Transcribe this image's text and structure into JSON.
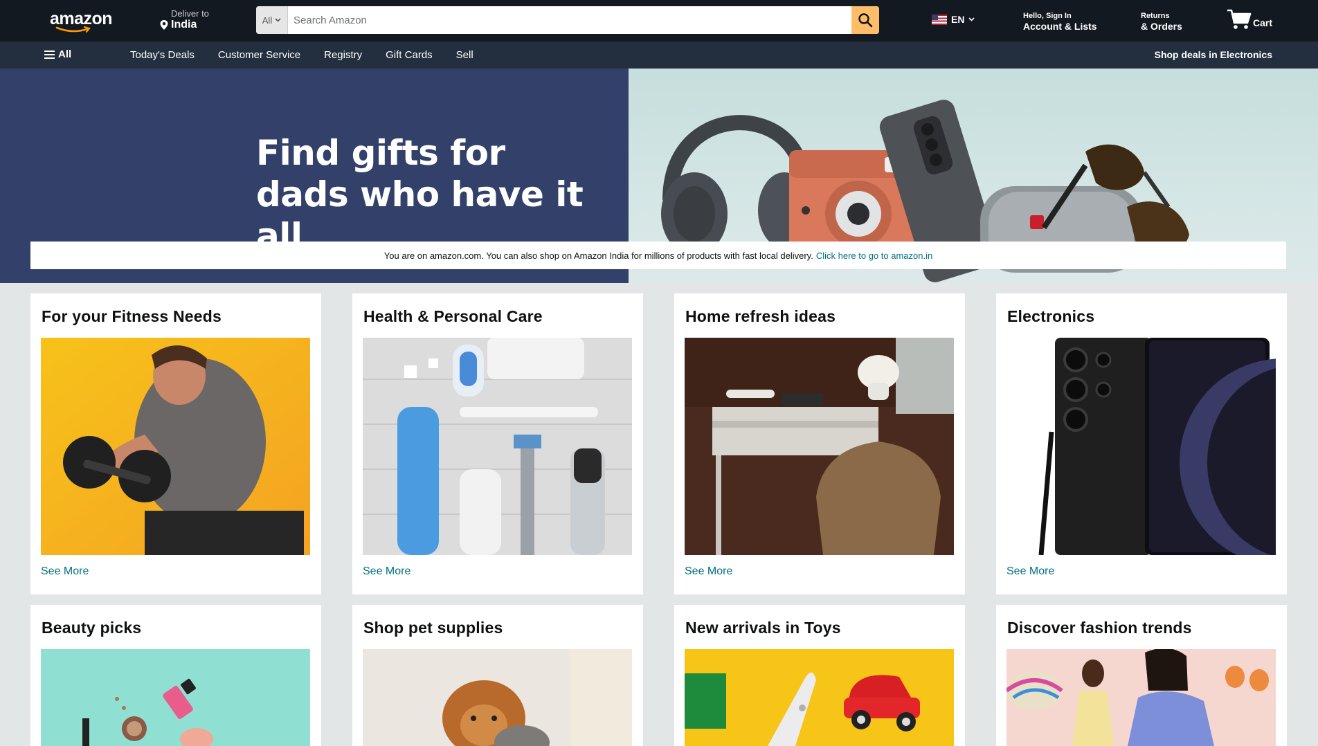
{
  "header": {
    "logo_text": "amazon",
    "deliver_label": "Deliver to",
    "deliver_location": "India",
    "search_category": "All",
    "search_placeholder": "Search Amazon",
    "language": "EN",
    "account_greeting": "Hello, Sign In",
    "account_label": "Account & Lists",
    "returns_label": "Returns",
    "orders_label": "& Orders",
    "cart_label": "Cart"
  },
  "subnav": {
    "all_label": "All",
    "links": [
      "Today's Deals",
      "Customer Service",
      "Registry",
      "Gift Cards",
      "Sell"
    ],
    "promo": "Shop deals in Electronics"
  },
  "hero": {
    "title_line1": "Find gifts for",
    "title_line2": "dads who have it all"
  },
  "notice": {
    "text": "You are on amazon.com. You can also shop on Amazon India for millions of products with fast local delivery.",
    "link": "Click here to go to amazon.in"
  },
  "cards": [
    {
      "title": "For your Fitness Needs",
      "link": "See More"
    },
    {
      "title": "Health & Personal Care",
      "link": "See More"
    },
    {
      "title": "Home refresh ideas",
      "link": "See More"
    },
    {
      "title": "Electronics",
      "link": "See More"
    },
    {
      "title": "Beauty picks",
      "link": ""
    },
    {
      "title": "Shop pet supplies",
      "link": ""
    },
    {
      "title": "New arrivals in Toys",
      "link": ""
    },
    {
      "title": "Discover fashion trends",
      "link": ""
    }
  ],
  "colors": {
    "nav_top": "#131921",
    "nav_sub": "#232f3e",
    "search_button": "#febd69",
    "hero_left": "#33416a",
    "link": "#007185",
    "page_bg": "#e3e6e6"
  },
  "icons": [
    "location-pin-icon",
    "search-icon",
    "us-flag-icon",
    "chevron-down-icon",
    "cart-icon",
    "hamburger-menu-icon"
  ]
}
